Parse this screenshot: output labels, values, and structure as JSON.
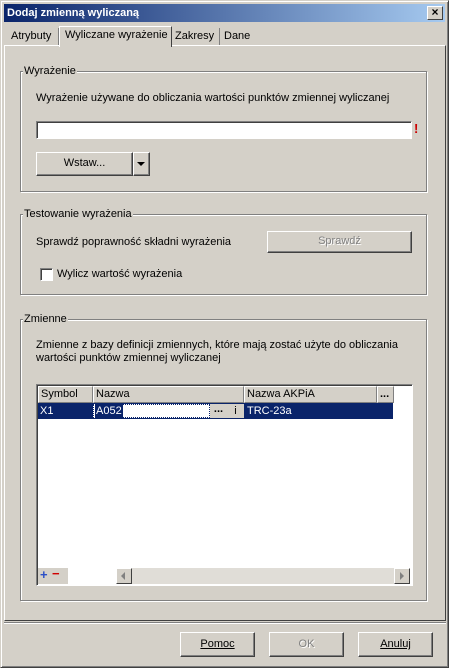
{
  "window": {
    "title": "Dodaj zmienną wyliczaną",
    "close_glyph": "×"
  },
  "tabs": [
    {
      "label": "Atrybuty",
      "selected": false
    },
    {
      "label": "Wyliczane wyrażenie",
      "selected": true
    },
    {
      "label": "Zakresy",
      "selected": false
    },
    {
      "label": "Dane",
      "selected": false
    }
  ],
  "expression": {
    "legend": "Wyrażenie",
    "description": "Wyrażenie używane do obliczania wartości punktów zmiennej wyliczanej",
    "value": "",
    "required_marker": "!",
    "insert_button": "Wstaw..."
  },
  "testing": {
    "legend": "Testowanie wyrażenia",
    "description": "Sprawdź poprawność składni wyrażenia",
    "check_button": "Sprawdź",
    "compute_label": "Wylicz wartość wyrażenia",
    "compute_checked": false
  },
  "variables": {
    "legend": "Zmienne",
    "description_line1": "Zmienne z bazy definicji zmiennych, które mają zostać użyte do obliczania",
    "description_line2": "wartości punktów zmiennej wyliczanej",
    "columns": {
      "symbol": "Symbol",
      "name": "Nazwa",
      "akpia": "Nazwa AKPiA",
      "more": "..."
    },
    "rows": [
      {
        "symbol": "X1",
        "name": "A052",
        "ellipsis": "...",
        "info": "i",
        "akpia": "TRC-23a"
      }
    ],
    "add_glyph": "+",
    "remove_glyph": "−",
    "add_color": "#2b4fc7",
    "remove_color": "#d00000"
  },
  "footer": {
    "help": "Pomoc",
    "ok": "OK",
    "cancel": "Anuluj"
  },
  "colors": {
    "titlebar_start": "#0a246a",
    "titlebar_end": "#a6caf0",
    "selection": "#0a246a",
    "required": "#cc0000"
  }
}
